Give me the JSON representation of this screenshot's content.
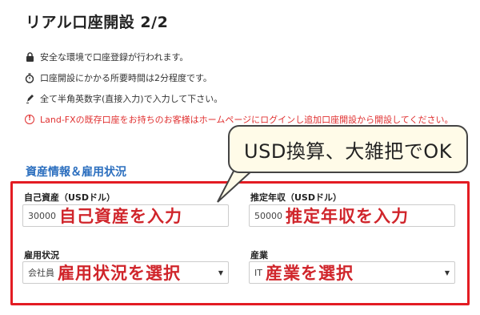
{
  "page": {
    "title": "リアル口座開設 2/2"
  },
  "info": [
    {
      "icon": "lock-icon",
      "glyph": "🔒",
      "text": "安全な環境で口座登録が行われます。",
      "warn": false
    },
    {
      "icon": "stopwatch-icon",
      "glyph": "⏱",
      "text": "口座開設にかかる所要時間は2分程度です。",
      "warn": false
    },
    {
      "icon": "pen-icon",
      "glyph": "✎",
      "text": "全て半角英数字(直接入力)で入力して下さい。",
      "warn": false
    },
    {
      "icon": "alert-icon",
      "glyph": "!",
      "text": "Land-FXの既存口座をお持ちのお客様はホームページにログインし追加口座開設から開設してください。",
      "warn": true
    }
  ],
  "section": {
    "title": "資産情報＆雇用状況"
  },
  "callout": {
    "text": "USD換算、大雑把でOK"
  },
  "fields": {
    "assets": {
      "label": "自己資産（USDドル）",
      "value": "30000",
      "overlay": "自己資産を入力"
    },
    "income": {
      "label": "推定年収（USDドル）",
      "value": "50000",
      "overlay": "推定年収を入力"
    },
    "employment": {
      "label": "雇用状況",
      "value": "会社員",
      "overlay": "雇用状況を選択"
    },
    "industry": {
      "label": "産業",
      "value": "IT",
      "overlay": "産業を選択"
    }
  },
  "colors": {
    "accent": "#2c6fbf",
    "highlight": "#e31c23",
    "overlay_text": "#d0252b",
    "warn": "#e03030"
  }
}
